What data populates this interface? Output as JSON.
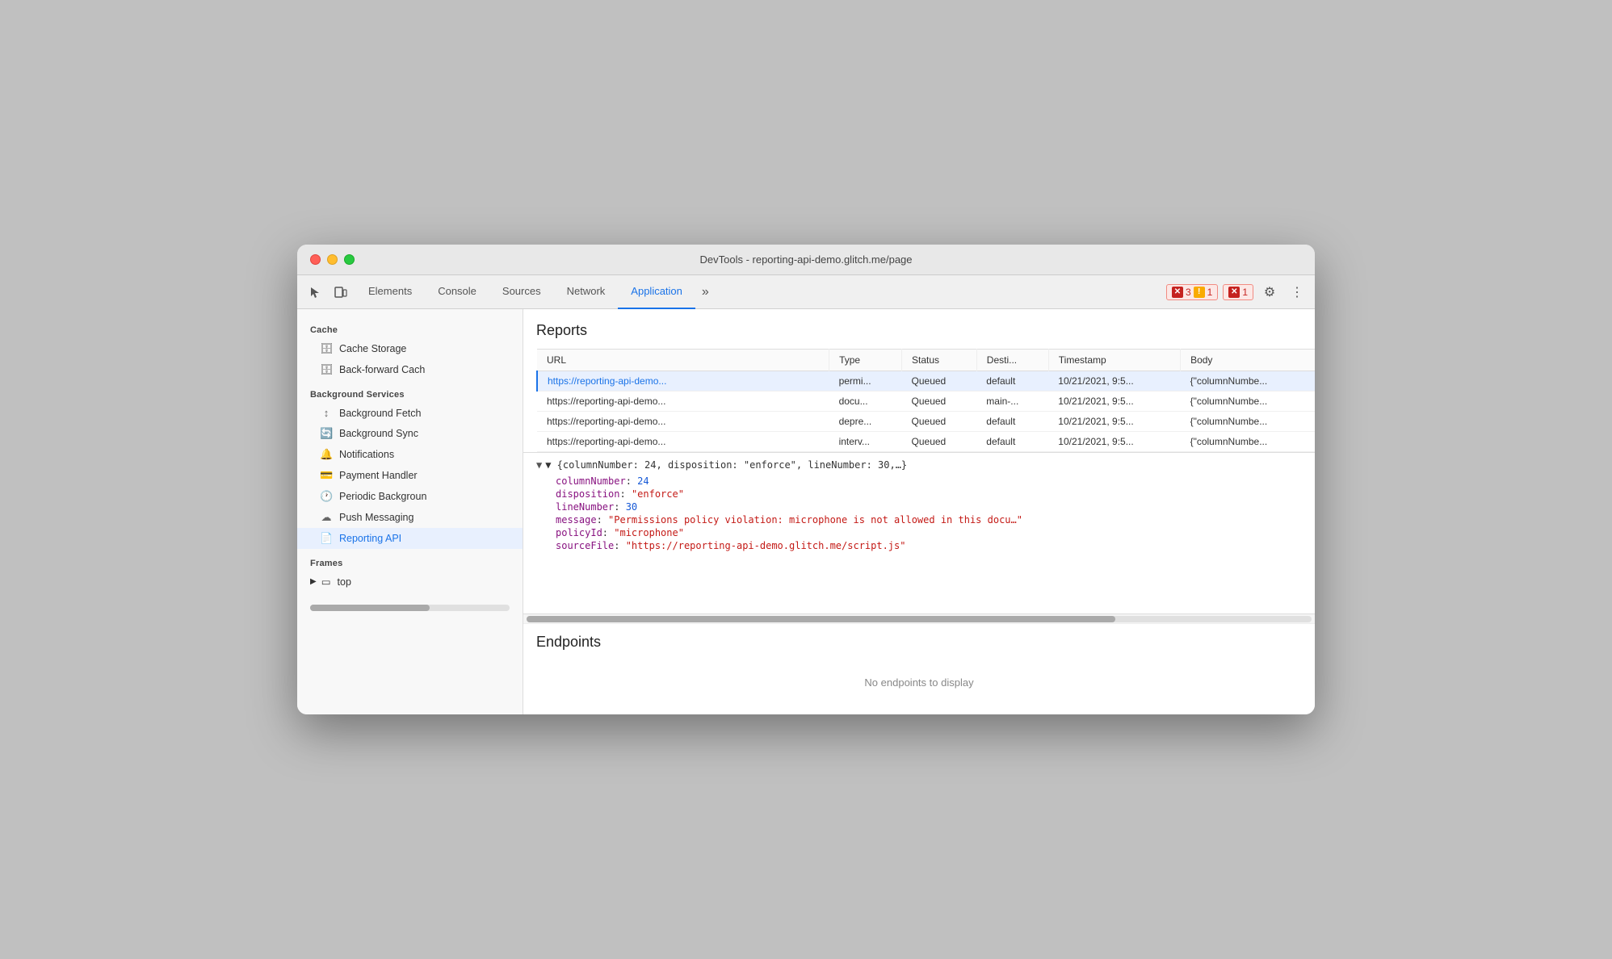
{
  "window": {
    "title": "DevTools - reporting-api-demo.glitch.me/page"
  },
  "toolbar": {
    "tabs": [
      {
        "id": "elements",
        "label": "Elements",
        "active": false
      },
      {
        "id": "console",
        "label": "Console",
        "active": false
      },
      {
        "id": "sources",
        "label": "Sources",
        "active": false
      },
      {
        "id": "network",
        "label": "Network",
        "active": false
      },
      {
        "id": "application",
        "label": "Application",
        "active": true
      }
    ],
    "more_tabs": "»",
    "errors": {
      "red_count": "3",
      "yellow_count": "1",
      "red2_count": "1"
    },
    "settings_icon": "⚙",
    "more_icon": "⋮"
  },
  "sidebar": {
    "cache_section": "Cache",
    "cache_items": [
      {
        "id": "cache-storage",
        "label": "Cache Storage",
        "icon": "🗄"
      },
      {
        "id": "back-forward",
        "label": "Back-forward Cach",
        "icon": "🗄"
      }
    ],
    "background_services_section": "Background Services",
    "bg_items": [
      {
        "id": "background-fetch",
        "label": "Background Fetch",
        "icon": "↕"
      },
      {
        "id": "background-sync",
        "label": "Background Sync",
        "icon": "🔄"
      },
      {
        "id": "notifications",
        "label": "Notifications",
        "icon": "🔔"
      },
      {
        "id": "payment-handler",
        "label": "Payment Handler",
        "icon": "💳"
      },
      {
        "id": "periodic-background",
        "label": "Periodic Backgroun",
        "icon": "🕐"
      },
      {
        "id": "push-messaging",
        "label": "Push Messaging",
        "icon": "☁"
      },
      {
        "id": "reporting-api",
        "label": "Reporting API",
        "icon": "📄",
        "active": true
      }
    ],
    "frames_section": "Frames",
    "frames_items": [
      {
        "id": "top",
        "label": "top",
        "icon": "▭"
      }
    ]
  },
  "reports": {
    "title": "Reports",
    "columns": [
      "URL",
      "Type",
      "Status",
      "Desti...",
      "Timestamp",
      "Body"
    ],
    "rows": [
      {
        "url": "https://reporting-api-demo...",
        "type": "permi...",
        "status": "Queued",
        "dest": "default",
        "timestamp": "10/21/2021, 9:5...",
        "body": "{\"columnNumbe...",
        "selected": true
      },
      {
        "url": "https://reporting-api-demo...",
        "type": "docu...",
        "status": "Queued",
        "dest": "main-...",
        "timestamp": "10/21/2021, 9:5...",
        "body": "{\"columnNumbe...",
        "selected": false
      },
      {
        "url": "https://reporting-api-demo...",
        "type": "depre...",
        "status": "Queued",
        "dest": "default",
        "timestamp": "10/21/2021, 9:5...",
        "body": "{\"columnNumbe...",
        "selected": false
      },
      {
        "url": "https://reporting-api-demo...",
        "type": "interv...",
        "status": "Queued",
        "dest": "default",
        "timestamp": "10/21/2021, 9:5...",
        "body": "{\"columnNumbe...",
        "selected": false
      }
    ],
    "detail": {
      "summary": "▼ {columnNumber: 24, disposition: \"enforce\", lineNumber: 30,…}",
      "rows": [
        {
          "prop": "columnNumber",
          "value": "24",
          "type": "number"
        },
        {
          "prop": "disposition",
          "value": "\"enforce\"",
          "type": "string"
        },
        {
          "prop": "lineNumber",
          "value": "30",
          "type": "number"
        },
        {
          "prop": "message",
          "value": "\"Permissions policy violation: microphone is not allowed in this docu…\"",
          "type": "string"
        },
        {
          "prop": "policyId",
          "value": "\"microphone\"",
          "type": "string"
        },
        {
          "prop": "sourceFile",
          "value": "\"https://reporting-api-demo.glitch.me/script.js\"",
          "type": "string"
        }
      ]
    }
  },
  "endpoints": {
    "title": "Endpoints",
    "empty_message": "No endpoints to display"
  }
}
